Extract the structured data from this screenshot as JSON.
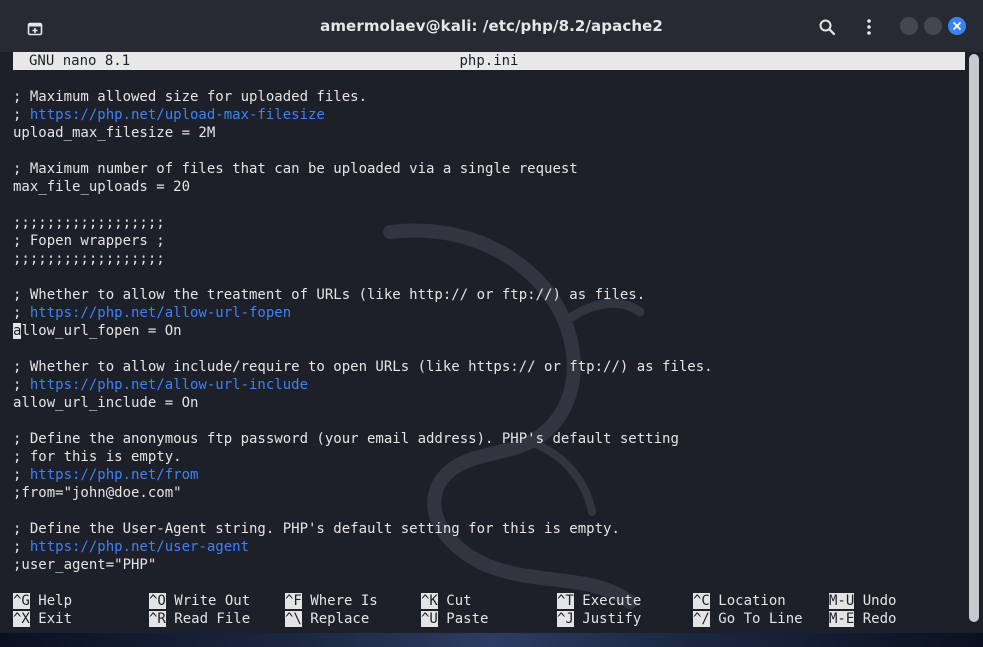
{
  "window": {
    "title": "amermolaev@kali: /etc/php/8.2/apache2",
    "icons": {
      "new_tab": "new-tab-icon",
      "search": "search-icon",
      "menu": "kebab-menu-icon",
      "minimize": "minimize-icon",
      "maximize": "maximize-icon",
      "close": "close-icon"
    },
    "colors": {
      "close": "#3b82f6",
      "titlebar": "#262a33",
      "terminal_bg": "#1d2029",
      "link": "#3b82f6"
    }
  },
  "nano": {
    "version": "GNU nano 8.1",
    "filename": "php.ini"
  },
  "editor": {
    "lines": [
      {
        "pre": "; Maximum allowed size for uploaded files.",
        "url": ""
      },
      {
        "pre": "; ",
        "url": "https://php.net/upload-max-filesize"
      },
      {
        "pre": "upload_max_filesize = 2M",
        "url": ""
      },
      {
        "pre": "",
        "url": ""
      },
      {
        "pre": "; Maximum number of files that can be uploaded via a single request",
        "url": ""
      },
      {
        "pre": "max_file_uploads = 20",
        "url": ""
      },
      {
        "pre": "",
        "url": ""
      },
      {
        "pre": ";;;;;;;;;;;;;;;;;;",
        "url": ""
      },
      {
        "pre": "; Fopen wrappers ;",
        "url": ""
      },
      {
        "pre": ";;;;;;;;;;;;;;;;;;",
        "url": ""
      },
      {
        "pre": "",
        "url": ""
      },
      {
        "pre": "; Whether to allow the treatment of URLs (like http:// or ftp://) as files.",
        "url": ""
      },
      {
        "pre": "; ",
        "url": "https://php.net/allow-url-fopen"
      },
      {
        "pre": "",
        "url": "",
        "cursor": "a",
        "post": "llow_url_fopen = On"
      },
      {
        "pre": "",
        "url": ""
      },
      {
        "pre": "; Whether to allow include/require to open URLs (like https:// or ftp://) as files.",
        "url": ""
      },
      {
        "pre": "; ",
        "url": "https://php.net/allow-url-include"
      },
      {
        "pre": "allow_url_include = On",
        "url": ""
      },
      {
        "pre": "",
        "url": ""
      },
      {
        "pre": "; Define the anonymous ftp password (your email address). PHP's default setting",
        "url": ""
      },
      {
        "pre": "; for this is empty.",
        "url": ""
      },
      {
        "pre": "; ",
        "url": "https://php.net/from"
      },
      {
        "pre": ";from=\"john@doe.com\"",
        "url": ""
      },
      {
        "pre": "",
        "url": ""
      },
      {
        "pre": "; Define the User-Agent string. PHP's default setting for this is empty.",
        "url": ""
      },
      {
        "pre": "; ",
        "url": "https://php.net/user-agent"
      },
      {
        "pre": ";user_agent=\"PHP\"",
        "url": ""
      }
    ]
  },
  "shortcuts": [
    [
      {
        "key": "^G",
        "label": "Help"
      },
      {
        "key": "^X",
        "label": "Exit"
      }
    ],
    [
      {
        "key": "^O",
        "label": "Write Out"
      },
      {
        "key": "^R",
        "label": "Read File"
      }
    ],
    [
      {
        "key": "^F",
        "label": "Where Is"
      },
      {
        "key": "^\\",
        "label": "Replace"
      }
    ],
    [
      {
        "key": "^K",
        "label": "Cut"
      },
      {
        "key": "^U",
        "label": "Paste"
      }
    ],
    [
      {
        "key": "^T",
        "label": "Execute"
      },
      {
        "key": "^J",
        "label": "Justify"
      }
    ],
    [
      {
        "key": "^C",
        "label": "Location"
      },
      {
        "key": "^/",
        "label": "Go To Line"
      }
    ],
    [
      {
        "key": "M-U",
        "label": "Undo"
      },
      {
        "key": "M-E",
        "label": "Redo"
      }
    ]
  ]
}
